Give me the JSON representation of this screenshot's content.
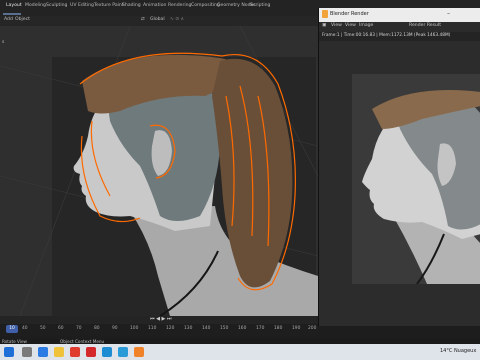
{
  "workspace_tabs": [
    "Layout",
    "Modeling",
    "Sculpting",
    "UV Editing",
    "Texture Paint",
    "Shading",
    "Animation",
    "Rendering",
    "Compositing",
    "Geometry Nodes",
    "Scripting"
  ],
  "viewport_header": {
    "menu": [
      "Add",
      "Object"
    ],
    "transform": "Global",
    "left_label": "s"
  },
  "render_window": {
    "title": "Blender Render",
    "menu": [
      "View",
      "View",
      "Image"
    ],
    "slot": "Render Result",
    "stats": "Frame:1 | Time:00:16.83 | Mem:1172.13M (Peak 1463.48M)"
  },
  "timeline": {
    "current_frame": "10",
    "ticks": [
      "40",
      "50",
      "60",
      "70",
      "80",
      "90",
      "100",
      "110",
      "120",
      "130",
      "140",
      "150",
      "160",
      "170",
      "180",
      "190",
      "200"
    ]
  },
  "status_bar": {
    "left": "Rotate View",
    "middle": "Object Context Menu"
  },
  "taskbar": {
    "weather": "14°C  Nuageux"
  },
  "colors": {
    "selection_outline": "#ff6a00",
    "active_frame": "#3f5fa8",
    "viewport_bg": "#2f2f2f"
  }
}
